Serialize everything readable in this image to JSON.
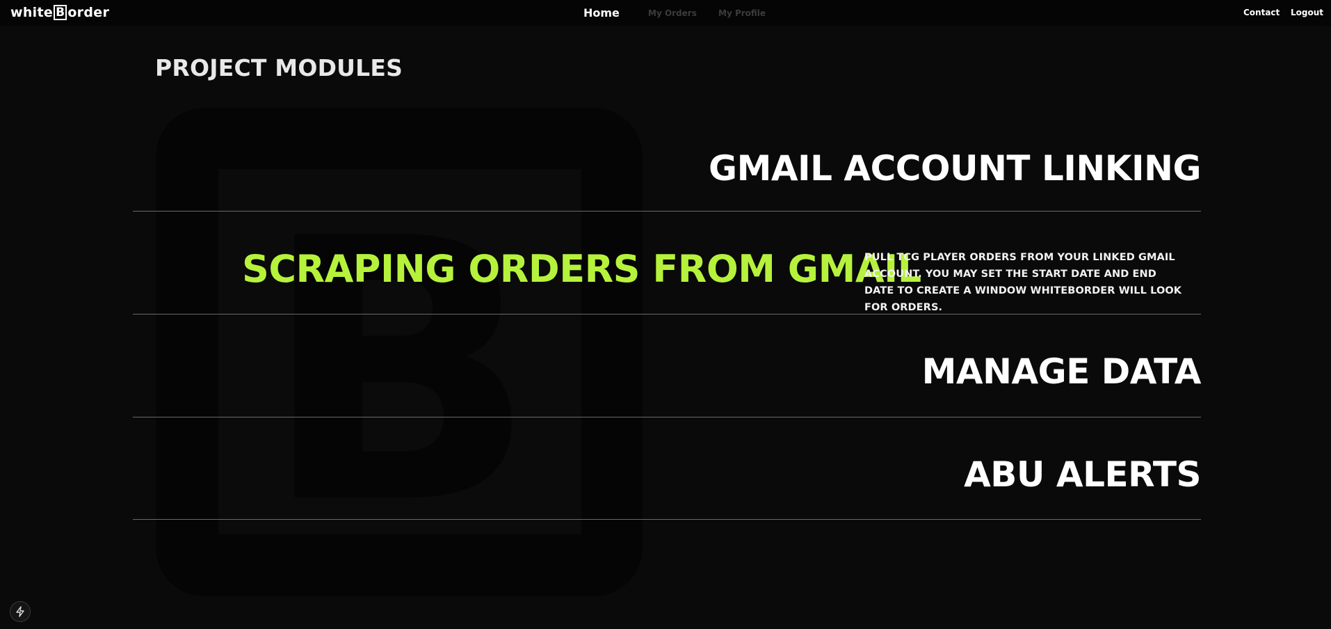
{
  "header": {
    "logo": {
      "prefix": "white",
      "boxed_letter": "B",
      "suffix": "order"
    },
    "nav": {
      "home": "Home",
      "orders": "My Orders",
      "profile": "My Profile"
    },
    "right": {
      "contact": "Contact",
      "logout": "Logout"
    }
  },
  "main": {
    "section_title": "PROJECT MODULES",
    "watermark_letter": "B",
    "modules": [
      {
        "title": "GMAIL ACCOUNT LINKING"
      },
      {
        "title": "SCRAPING ORDERS FROM GMAIL",
        "description": "PULL TCG PLAYER ORDERS FROM YOUR LINKED GMAIL ACCOUNT. YOU MAY SET THE START DATE AND END DATE TO CREATE A WINDOW WHITEBORDER WILL LOOK FOR ORDERS.",
        "active": true
      },
      {
        "title": "MANAGE DATA"
      },
      {
        "title": "ABU ALERTS"
      }
    ]
  },
  "footer": {
    "bolt_icon": "bolt-icon"
  },
  "colors": {
    "background": "#0a0a0a",
    "navbar": "#050505",
    "accent": "#b6f23c",
    "divider": "#6a6a6a",
    "inactive_nav": "#3c3c3c"
  }
}
